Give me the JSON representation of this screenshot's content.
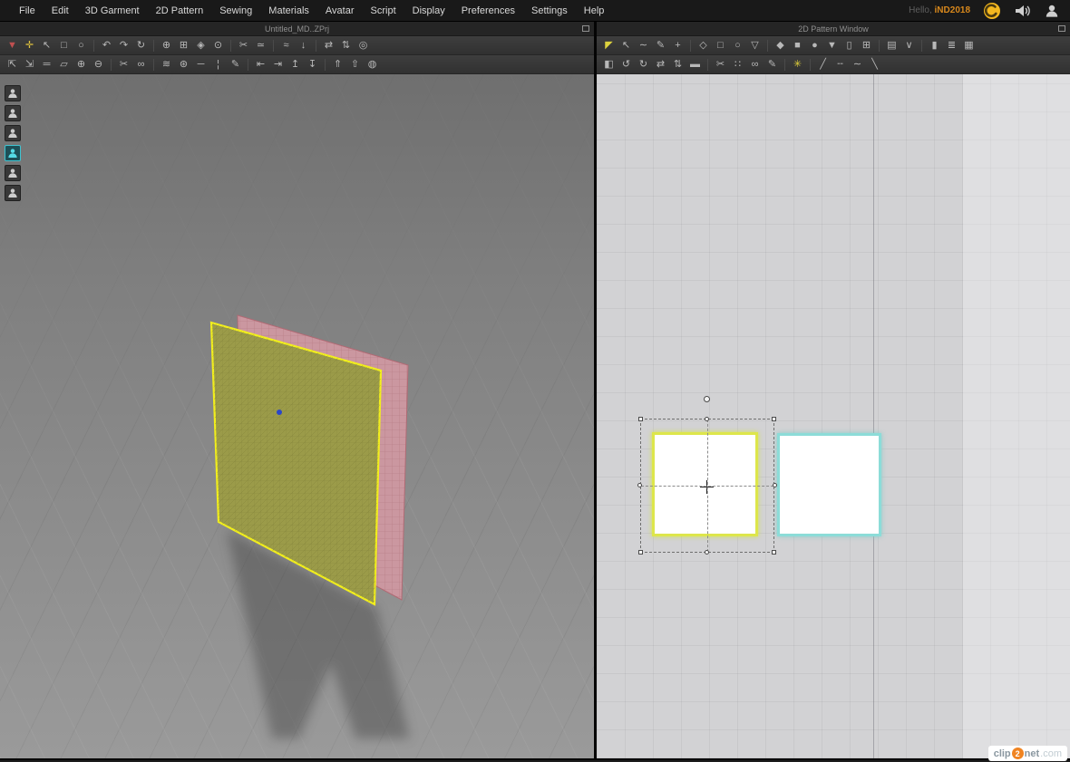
{
  "menu_bar": {
    "items": [
      {
        "label": "File"
      },
      {
        "label": "Edit"
      },
      {
        "label": "3D Garment"
      },
      {
        "label": "2D Pattern"
      },
      {
        "label": "Sewing"
      },
      {
        "label": "Materials"
      },
      {
        "label": "Avatar"
      },
      {
        "label": "Script"
      },
      {
        "label": "Display"
      },
      {
        "label": "Preferences"
      },
      {
        "label": "Settings"
      },
      {
        "label": "Help"
      }
    ],
    "greeting": "Hello,",
    "username": "iND2018"
  },
  "panels": {
    "left": {
      "title": "Untitled_MD..ZPrj",
      "toolbar_row1": [
        {
          "name": "simulate-button",
          "glyph": "▼",
          "color": "#c05050"
        },
        {
          "name": "pin-move-tool",
          "glyph": "✛",
          "color": "#e2c53e"
        },
        {
          "name": "select-move-tool",
          "glyph": "↖"
        },
        {
          "name": "rectangle-select-tool",
          "glyph": "□"
        },
        {
          "name": "lasso-select-tool",
          "glyph": "○"
        },
        {
          "name": "separator"
        },
        {
          "name": "undo-button",
          "glyph": "↶"
        },
        {
          "name": "redo-button",
          "glyph": "↷"
        },
        {
          "name": "reset-arrangement-button",
          "glyph": "↻"
        },
        {
          "name": "separator"
        },
        {
          "name": "pin-tool",
          "glyph": "⊕"
        },
        {
          "name": "pin-box-tool",
          "glyph": "⊞"
        },
        {
          "name": "fold-arrangement-tool",
          "glyph": "◈"
        },
        {
          "name": "tack-on-avatar-tool",
          "glyph": "⊙"
        },
        {
          "name": "separator"
        },
        {
          "name": "sewing-tool",
          "glyph": "✂"
        },
        {
          "name": "seam-edit-tool",
          "glyph": "≃"
        },
        {
          "name": "separator"
        },
        {
          "name": "wind-controller-tool",
          "glyph": "≈"
        },
        {
          "name": "gravity-tool",
          "glyph": "↓"
        },
        {
          "name": "separator"
        },
        {
          "name": "sync-toggle",
          "glyph": "⇄"
        },
        {
          "name": "updown-sync-toggle",
          "glyph": "⇅"
        },
        {
          "name": "world-axis-toggle",
          "glyph": "◎"
        }
      ],
      "toolbar_row2": [
        {
          "name": "avatar-gizmo-tool",
          "glyph": "⇱"
        },
        {
          "name": "avatar-scale-tool",
          "glyph": "⇲"
        },
        {
          "name": "tape-measure-tool",
          "glyph": "═"
        },
        {
          "name": "flatten-tool",
          "glyph": "▱"
        },
        {
          "name": "pin-add-tool",
          "glyph": "⊕"
        },
        {
          "name": "pin-remove-tool",
          "glyph": "⊖"
        },
        {
          "name": "separator"
        },
        {
          "name": "sewing-scissors-tool",
          "glyph": "✂"
        },
        {
          "name": "sewing-merge-tool",
          "glyph": "∞"
        },
        {
          "name": "separator"
        },
        {
          "name": "steam-brush-tool",
          "glyph": "≋"
        },
        {
          "name": "solidify-brush-tool",
          "glyph": "⊛"
        },
        {
          "name": "measure-line-tool",
          "glyph": "─"
        },
        {
          "name": "thermometer-tool",
          "glyph": "¦"
        },
        {
          "name": "style-dropper-tool",
          "glyph": "✎"
        },
        {
          "name": "separator"
        },
        {
          "name": "align-left-button",
          "glyph": "⇤"
        },
        {
          "name": "align-right-button",
          "glyph": "⇥"
        },
        {
          "name": "align-top-button",
          "glyph": "↥"
        },
        {
          "name": "align-bottom-button",
          "glyph": "↧"
        },
        {
          "name": "separator"
        },
        {
          "name": "raise-garment-button",
          "glyph": "⇑"
        },
        {
          "name": "lift-garment-button",
          "glyph": "⇧"
        },
        {
          "name": "world-view-button",
          "glyph": "◍"
        }
      ],
      "side_tools": [
        {
          "name": "show-avatar-toggle"
        },
        {
          "name": "show-hair-toggle"
        },
        {
          "name": "show-shoes-toggle"
        },
        {
          "name": "show-garment-toggle",
          "selected": true
        },
        {
          "name": "show-accessory-toggle"
        },
        {
          "name": "show-mannequin-toggle"
        }
      ]
    },
    "right": {
      "title": "2D Pattern Window",
      "toolbar_row1": [
        {
          "name": "transform-pattern-tool",
          "glyph": "◤",
          "color": "#ddd23e"
        },
        {
          "name": "edit-pattern-tool",
          "glyph": "↖"
        },
        {
          "name": "edit-curvature-tool",
          "glyph": "∼"
        },
        {
          "name": "edit-curve-point-tool",
          "glyph": "✎"
        },
        {
          "name": "add-point-tool",
          "glyph": "+"
        },
        {
          "name": "separator"
        },
        {
          "name": "polygon-tool",
          "glyph": "◇"
        },
        {
          "name": "rectangle-tool",
          "glyph": "□"
        },
        {
          "name": "circle-tool",
          "glyph": "○"
        },
        {
          "name": "dart-tool",
          "glyph": "▽"
        },
        {
          "name": "separator"
        },
        {
          "name": "inner-polygon-tool",
          "glyph": "◆"
        },
        {
          "name": "inner-rectangle-tool",
          "glyph": "■"
        },
        {
          "name": "inner-circle-tool",
          "glyph": "●"
        },
        {
          "name": "inner-dart-tool",
          "glyph": "▼"
        },
        {
          "name": "base-line-tool",
          "glyph": "▯"
        },
        {
          "name": "trace-tool",
          "glyph": "⊞"
        },
        {
          "name": "separator"
        },
        {
          "name": "seam-allowance-tool",
          "glyph": "▤"
        },
        {
          "name": "notch-tool",
          "glyph": "∨"
        },
        {
          "name": "separator"
        },
        {
          "name": "grading-tool",
          "glyph": "▮"
        },
        {
          "name": "annotation-tool",
          "glyph": "≣"
        },
        {
          "name": "texture-tool",
          "glyph": "▦"
        }
      ],
      "toolbar_row2": [
        {
          "name": "unfold-tool",
          "glyph": "◧"
        },
        {
          "name": "rotate-ccw-tool",
          "glyph": "↺"
        },
        {
          "name": "rotate-cw-tool",
          "glyph": "↻"
        },
        {
          "name": "flip-horizontal-tool",
          "glyph": "⇄"
        },
        {
          "name": "flip-vertical-tool",
          "glyph": "⇅"
        },
        {
          "name": "press-tool",
          "glyph": "▬"
        },
        {
          "name": "separator"
        },
        {
          "name": "sew-free-tool",
          "glyph": "✂"
        },
        {
          "name": "sew-segment-tool",
          "glyph": "∷"
        },
        {
          "name": "sew-multi-tool",
          "glyph": "∞"
        },
        {
          "name": "edit-sewing-tool",
          "glyph": "✎"
        },
        {
          "name": "separator"
        },
        {
          "name": "show-seam-toggle",
          "glyph": "✳",
          "color": "#e0cf3a"
        },
        {
          "name": "separator"
        },
        {
          "name": "line-tool",
          "glyph": "╱"
        },
        {
          "name": "dashed-line-tool",
          "glyph": "╌"
        },
        {
          "name": "wave-line-tool",
          "glyph": "∼"
        },
        {
          "name": "knife-tool",
          "glyph": "╲"
        }
      ]
    }
  },
  "colors": {
    "accent_orange": "#d8881c",
    "selected_teal": "#3fc3d0",
    "pattern_yellow": "#dde64b",
    "pattern_cyan": "#8cdcd8",
    "garment_olive": "#9b9b49",
    "garment_outline": "#f2ef1d",
    "back_pink": "#cb97a0",
    "back_outline": "#b06a74",
    "pin_blue": "#2a46c8"
  },
  "watermark": {
    "part1": "clip",
    "part2": "2",
    "part3": "net",
    "part4": ".com"
  }
}
